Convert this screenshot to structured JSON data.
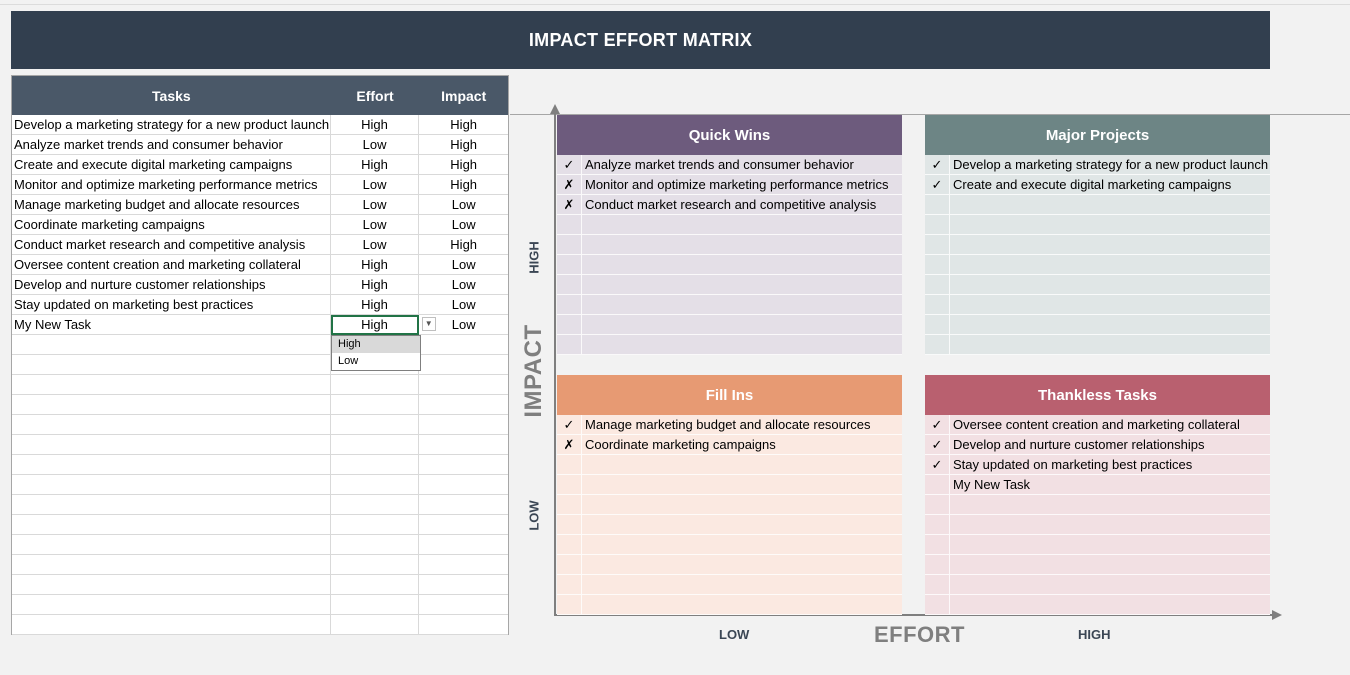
{
  "banner": {
    "title": "IMPACT EFFORT MATRIX"
  },
  "table": {
    "headers": {
      "task": "Tasks",
      "effort": "Effort",
      "impact": "Impact"
    },
    "rows": [
      {
        "task": "Develop a marketing strategy for a new product launch",
        "effort": "High",
        "impact": "High"
      },
      {
        "task": "Analyze market trends and consumer behavior",
        "effort": "Low",
        "impact": "High"
      },
      {
        "task": "Create and execute digital marketing campaigns",
        "effort": "High",
        "impact": "High"
      },
      {
        "task": "Monitor and optimize marketing performance metrics",
        "effort": "Low",
        "impact": "High"
      },
      {
        "task": "Manage marketing budget and allocate resources",
        "effort": "Low",
        "impact": "Low"
      },
      {
        "task": "Coordinate marketing campaigns",
        "effort": "Low",
        "impact": "Low"
      },
      {
        "task": "Conduct market research and competitive analysis",
        "effort": "Low",
        "impact": "High"
      },
      {
        "task": "Oversee content creation and marketing collateral",
        "effort": "High",
        "impact": "Low"
      },
      {
        "task": "Develop and nurture customer relationships",
        "effort": "High",
        "impact": "Low"
      },
      {
        "task": "Stay updated on marketing best practices",
        "effort": "High",
        "impact": "Low"
      },
      {
        "task": "My New Task",
        "effort": "High",
        "impact": "Low"
      }
    ],
    "empty_rows": 15
  },
  "dropdown": {
    "options": [
      "High",
      "Low"
    ],
    "highlighted": "High"
  },
  "axis": {
    "y_title": "IMPACT",
    "y_high": "HIGH",
    "y_low": "LOW",
    "x_title": "EFFORT",
    "x_low": "LOW",
    "x_high": "HIGH"
  },
  "quadrants": {
    "quick_wins": {
      "title": "Quick Wins",
      "items": [
        {
          "mark": "✓",
          "text": "Analyze market trends and consumer behavior"
        },
        {
          "mark": "✗",
          "text": "Monitor and optimize marketing performance metrics"
        },
        {
          "mark": "✗",
          "text": "Conduct market research and competitive analysis"
        }
      ]
    },
    "major_projects": {
      "title": "Major Projects",
      "items": [
        {
          "mark": "✓",
          "text": "Develop a marketing strategy for a new product launch"
        },
        {
          "mark": "✓",
          "text": "Create and execute digital marketing campaigns"
        }
      ]
    },
    "fill_ins": {
      "title": "Fill Ins",
      "items": [
        {
          "mark": "✓",
          "text": "Manage marketing budget and allocate resources"
        },
        {
          "mark": "✗",
          "text": "Coordinate marketing campaigns"
        }
      ]
    },
    "thankless_tasks": {
      "title": "Thankless Tasks",
      "items": [
        {
          "mark": "✓",
          "text": "Oversee content creation and marketing collateral"
        },
        {
          "mark": "✓",
          "text": "Develop and nurture customer relationships"
        },
        {
          "mark": "✓",
          "text": "Stay updated on marketing best practices"
        },
        {
          "mark": "",
          "text": "My New Task"
        }
      ]
    }
  },
  "colors": {
    "banner": "#323f4f",
    "quick_wins": "#6d5b7d",
    "major_projects": "#6d8585",
    "fill_ins": "#e79a73",
    "thankless_tasks": "#b9606f",
    "selection": "#217346"
  }
}
